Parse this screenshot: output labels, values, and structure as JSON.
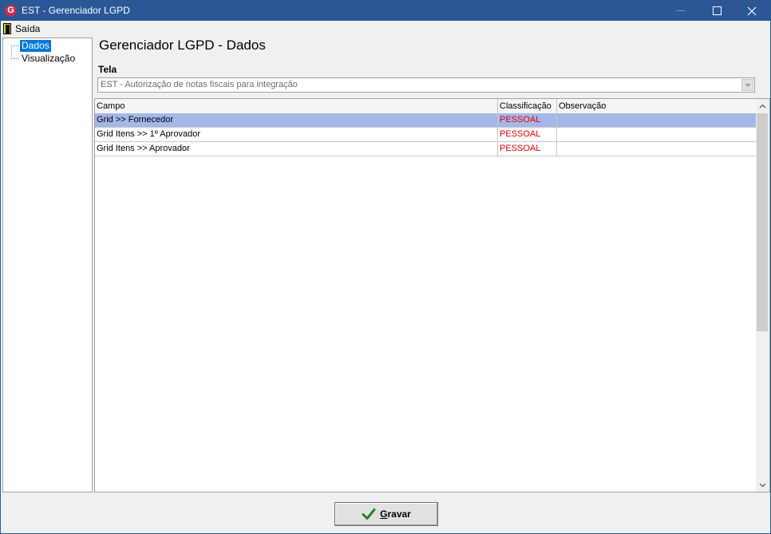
{
  "window": {
    "title": "EST - Gerenciador LGPD",
    "app_icon_letter": "G"
  },
  "menu": {
    "saida_label": "Saída"
  },
  "tree": {
    "items": [
      {
        "label": "Dados",
        "selected": true
      },
      {
        "label": "Visualização",
        "selected": false
      }
    ]
  },
  "main": {
    "title": "Gerenciador LGPD - Dados",
    "tela_label": "Tela",
    "tela_value": "EST - Autorização de notas fiscais para integração"
  },
  "grid": {
    "columns": [
      "Campo",
      "Classificação",
      "Observação"
    ],
    "rows": [
      {
        "campo": "Grid >> Fornecedor",
        "classificacao": "PESSOAL",
        "observacao": ""
      },
      {
        "campo": "Grid Itens >> 1º Aprovador",
        "classificacao": "PESSOAL",
        "observacao": ""
      },
      {
        "campo": "Grid Itens >> Aprovador",
        "classificacao": "PESSOAL",
        "observacao": ""
      }
    ]
  },
  "footer": {
    "gravar_first": "G",
    "gravar_rest": "ravar"
  },
  "colors": {
    "titlebar": "#2b5797",
    "selected_row": "#a3b8e8",
    "classification_text": "#e00000",
    "check": "#1a8a1a"
  },
  "icons": {
    "app": "app-logo-icon",
    "exit": "door-exit-icon",
    "save": "checkmark-icon"
  }
}
